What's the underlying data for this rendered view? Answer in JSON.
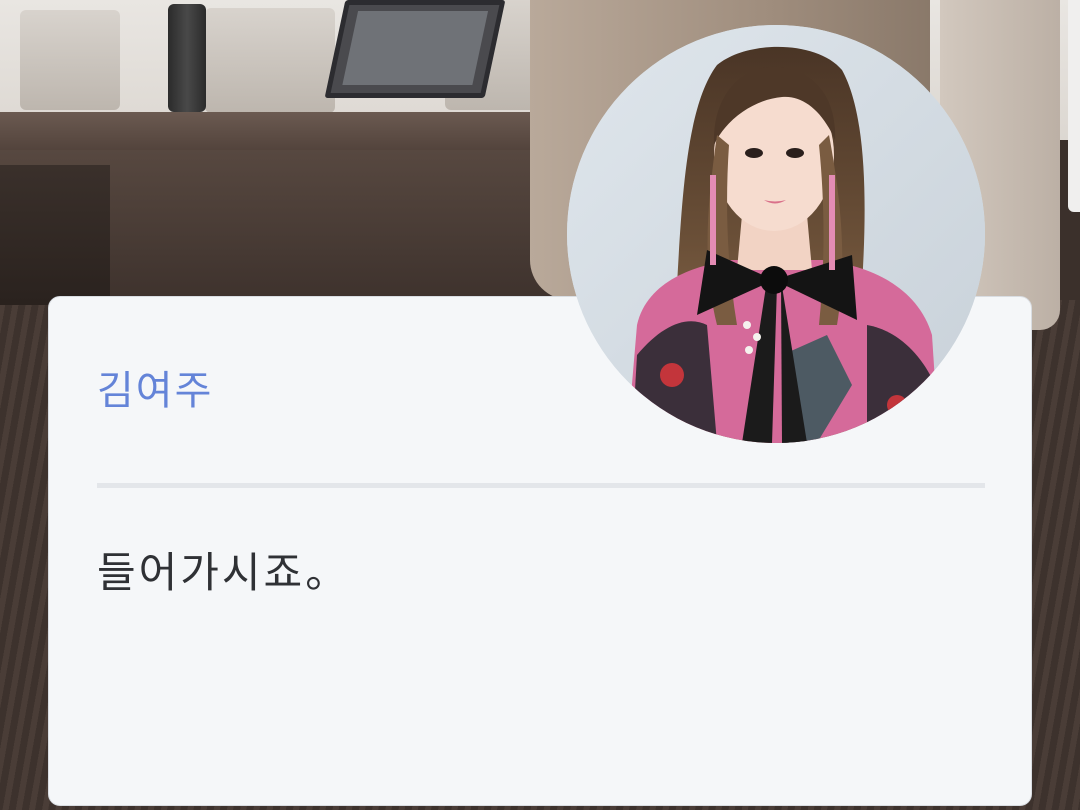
{
  "dialog": {
    "speaker_name": "김여주",
    "line": "들어가시죠。"
  },
  "colors": {
    "card_background": "#f5f7f9",
    "name_color": "#6484d8",
    "text_color": "#2f3135",
    "divider": "#e3e6ea"
  },
  "avatar": {
    "icon": "character-portrait-icon"
  }
}
